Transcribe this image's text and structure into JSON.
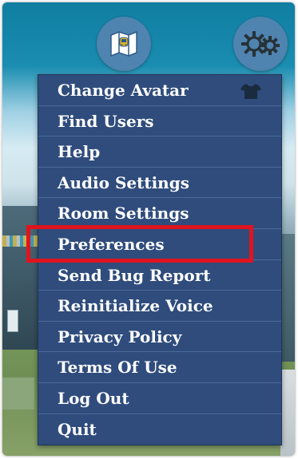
{
  "colors": {
    "menu_background": "#2f4c7c",
    "menu_text": "#ffffff",
    "icon_button_background": "#4f83b0",
    "highlight_border": "#e0141e"
  },
  "toolbar": {
    "map_button_icon": "map-icon",
    "settings_button_icon": "gears-icon"
  },
  "menu": {
    "items": [
      {
        "label": "Change Avatar",
        "icon": "tshirt-icon"
      },
      {
        "label": "Find Users"
      },
      {
        "label": "Help"
      },
      {
        "label": "Audio Settings"
      },
      {
        "label": "Room Settings"
      },
      {
        "label": "Preferences",
        "highlighted": true
      },
      {
        "label": "Send Bug Report"
      },
      {
        "label": "Reinitialize Voice"
      },
      {
        "label": "Privacy Policy"
      },
      {
        "label": "Terms Of Use"
      },
      {
        "label": "Log Out"
      },
      {
        "label": "Quit"
      }
    ]
  }
}
